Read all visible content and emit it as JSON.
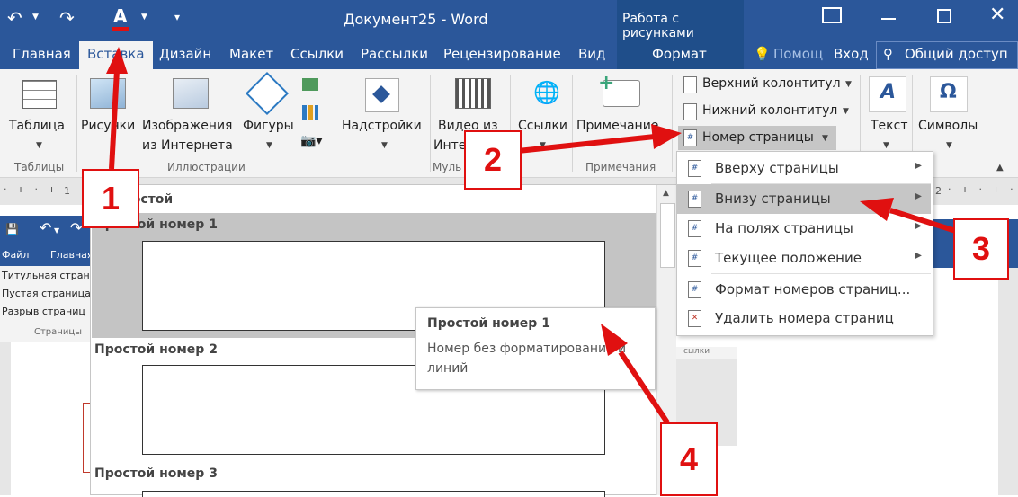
{
  "titlebar": {
    "title": "Документ25 - Word",
    "context_tab": "Работа с рисунками"
  },
  "tabs": {
    "home": "Главная",
    "insert": "Вставка",
    "design": "Дизайн",
    "layout": "Макет",
    "references": "Ссылки",
    "mailings": "Рассылки",
    "review": "Рецензирование",
    "view": "Вид",
    "format": "Формат",
    "tellme": "Помощ",
    "signin": "Вход",
    "share": "Общий доступ"
  },
  "ribbon": {
    "table": "Таблица",
    "pictures": "Рисунки",
    "online_pictures": [
      "Изображения",
      "из Интернета"
    ],
    "shapes": "Фигуры",
    "addins": "Надстройки",
    "video": [
      "Видео из",
      "Инте"
    ],
    "links": "Ссылки",
    "comment": "Примечание",
    "header": "Верхний колонтитул",
    "footer": "Нижний колонтитул",
    "page_number": "Номер страницы",
    "text": "Текст",
    "symbols": "Символы",
    "groups": {
      "tables": "Таблицы",
      "illustrations": "Иллюстрации",
      "media": "Муль",
      "comments": "Примечания"
    }
  },
  "ruler": {
    "tick1": "1",
    "tick2": "2"
  },
  "bg_doc": {
    "file": "Файл",
    "home": "Главная",
    "items": [
      "Титульная страни",
      "Пустая страница",
      "Разрыв страниц"
    ],
    "group": "Страницы",
    "partial": "сылки"
  },
  "gallery": {
    "category": "Простой",
    "items": [
      "Простой номер 1",
      "Простой номер 2",
      "Простой номер 3"
    ]
  },
  "tooltip": {
    "title": "Простой номер 1",
    "line1": "Номер без форматирования и",
    "line2": "линий"
  },
  "menu": {
    "items": [
      "Вверху страницы",
      "Внизу страницы",
      "На полях страницы",
      "Текущее положение",
      "Формат номеров страниц...",
      "Удалить номера страниц"
    ]
  },
  "callouts": [
    "1",
    "2",
    "3",
    "4"
  ],
  "colors": {
    "word_blue": "#2b579a",
    "annotation_red": "#e01010"
  }
}
